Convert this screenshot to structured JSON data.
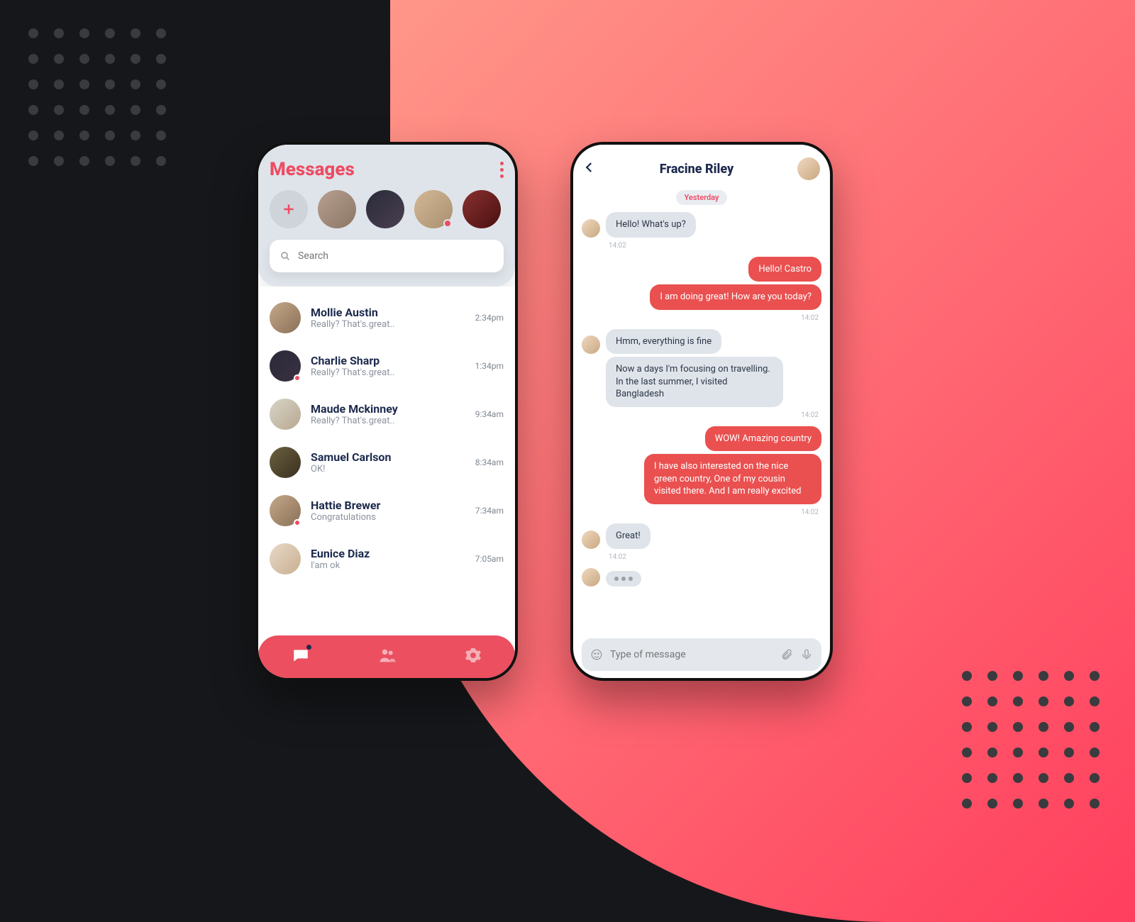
{
  "left": {
    "title": "Messages",
    "search_placeholder": "Search",
    "stories": [
      {
        "badge": false
      },
      {
        "badge": false
      },
      {
        "badge": true
      },
      {
        "badge": false
      }
    ],
    "conversations": [
      {
        "name": "Mollie Austin",
        "snippet": "Really? That's.great..",
        "time": "2:34pm",
        "badge": false
      },
      {
        "name": "Charlie Sharp",
        "snippet": "Really? That's.great..",
        "time": "1:34pm",
        "badge": true
      },
      {
        "name": "Maude Mckinney",
        "snippet": "Really? That's.great..",
        "time": "9:34am",
        "badge": false
      },
      {
        "name": "Samuel Carlson",
        "snippet": "OK!",
        "time": "8:34am",
        "badge": false
      },
      {
        "name": "Hattie Brewer",
        "snippet": "Congratulations",
        "time": "7:34am",
        "badge": true
      },
      {
        "name": "Eunice Diaz",
        "snippet": "I'am ok",
        "time": "7:05am",
        "badge": false
      }
    ]
  },
  "right": {
    "title": "Fracine Riley",
    "date_label": "Yesterday",
    "input_placeholder": "Type of message",
    "msgs": {
      "m1": {
        "text": "Hello! What's up?",
        "ts": "14:02"
      },
      "m2": {
        "text": "Hello! Castro",
        "ts": ""
      },
      "m3": {
        "text": "I am doing great! How are you today?",
        "ts": "14:02"
      },
      "m4": {
        "text": "Hmm, everything is fine",
        "ts": ""
      },
      "m5": {
        "text": "Now a days I'm focusing on travelling. In the last summer, I visited Bangladesh",
        "ts": "14:02"
      },
      "m6": {
        "text": "WOW! Amazing country",
        "ts": ""
      },
      "m7": {
        "text": "I have also interested on the nice green country, One of my cousin visited there. And I am really excited",
        "ts": "14:02"
      },
      "m8": {
        "text": "Great!",
        "ts": "14:02"
      }
    }
  }
}
